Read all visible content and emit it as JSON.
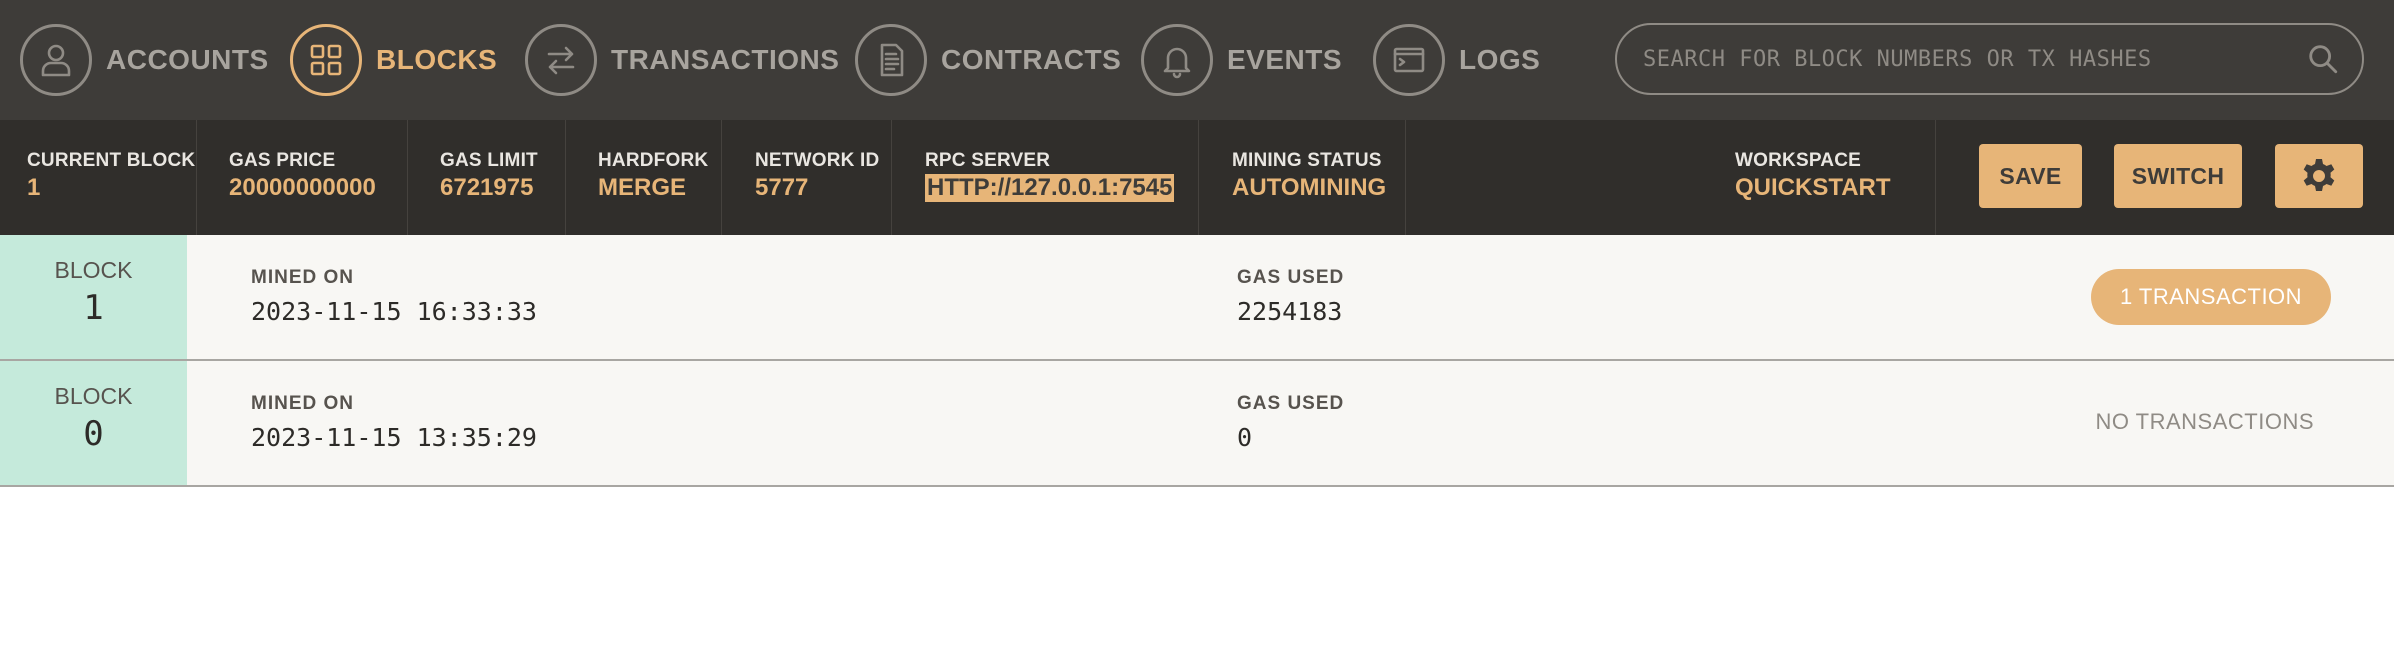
{
  "nav": {
    "items": [
      {
        "label": "ACCOUNTS",
        "icon": "user-icon",
        "active": false
      },
      {
        "label": "BLOCKS",
        "icon": "grid-icon",
        "active": true
      },
      {
        "label": "TRANSACTIONS",
        "icon": "swap-arrows-icon",
        "active": false
      },
      {
        "label": "CONTRACTS",
        "icon": "document-icon",
        "active": false
      },
      {
        "label": "EVENTS",
        "icon": "bell-icon",
        "active": false
      },
      {
        "label": "LOGS",
        "icon": "terminal-window-icon",
        "active": false
      }
    ],
    "search_placeholder": "SEARCH FOR BLOCK NUMBERS OR TX HASHES"
  },
  "status": {
    "current_block": {
      "label": "CURRENT BLOCK",
      "value": "1"
    },
    "gas_price": {
      "label": "GAS PRICE",
      "value": "20000000000"
    },
    "gas_limit": {
      "label": "GAS LIMIT",
      "value": "6721975"
    },
    "hardfork": {
      "label": "HARDFORK",
      "value": "MERGE"
    },
    "network_id": {
      "label": "NETWORK ID",
      "value": "5777"
    },
    "rpc_server": {
      "label": "RPC SERVER",
      "value": "HTTP://127.0.0.1:7545"
    },
    "mining_status": {
      "label": "MINING STATUS",
      "value": "AUTOMINING"
    },
    "workspace": {
      "label": "WORKSPACE",
      "value": "QUICKSTART"
    }
  },
  "buttons": {
    "save": "SAVE",
    "switch": "SWITCH",
    "settings_icon": "gear-icon"
  },
  "blocks": [
    {
      "label": "BLOCK",
      "number": "1",
      "mined_label": "MINED ON",
      "mined_on": "2023-11-15 16:33:33",
      "gas_label": "GAS USED",
      "gas_used": "2254183",
      "tx": "1 TRANSACTION",
      "has_tx": true
    },
    {
      "label": "BLOCK",
      "number": "0",
      "mined_label": "MINED ON",
      "mined_on": "2023-11-15 13:35:29",
      "gas_label": "GAS USED",
      "gas_used": "0",
      "tx": "NO TRANSACTIONS",
      "has_tx": false
    }
  ],
  "colors": {
    "accent": "#e7b578",
    "nav_bg": "#3e3c39",
    "status_bg": "#302e2b",
    "block_badge": "#c5eadb"
  }
}
